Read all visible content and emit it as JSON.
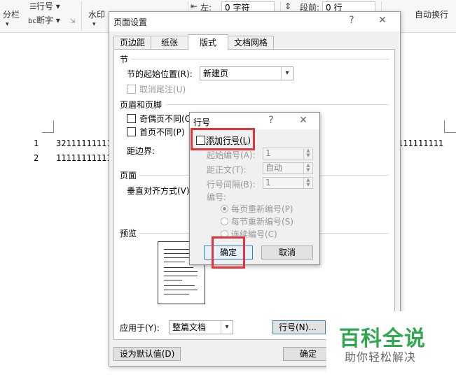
{
  "ribbon": {
    "columns_label": "分栏",
    "line_numbers_label": "行号",
    "hyphenation_label": "断字",
    "watermark_label": "水印",
    "left_indent_label": "左:",
    "left_indent_value": "0 字符",
    "spacing_before_label": "段前:",
    "spacing_before_value": "0 行",
    "auto_wrap_label": "自动换行"
  },
  "document": {
    "line1_number": "1",
    "line1_text": "32111111111",
    "line1_tail": "111111111",
    "line2_number": "2",
    "line2_text": "11111111111"
  },
  "page_setup": {
    "title": "页面设置",
    "help": "?",
    "close": "✕",
    "tabs": [
      "页边距",
      "纸张",
      "版式",
      "文档网格"
    ],
    "section_heading": "节",
    "section_start_label": "节的起始位置(R):",
    "section_start_value": "新建页",
    "suppress_endnotes_label": "取消尾注(U)",
    "header_footer_heading": "页眉和页脚",
    "odd_even_label": "奇偶页不同(O)",
    "first_page_label": "首页不同(P)",
    "from_edge_label": "距边界:",
    "page_heading": "页面",
    "vertical_align_label": "垂直对齐方式(V)",
    "preview_heading": "预览",
    "apply_to_label": "应用于(Y):",
    "apply_to_value": "整篇文档",
    "line_numbers_button": "行号(N)...",
    "set_default_button": "设为默认值(D)",
    "ok_button": "确定"
  },
  "line_numbers_dialog": {
    "title": "行号",
    "help": "?",
    "close": "✕",
    "add_line_numbers_label": "添加行号(L)",
    "start_at_label": "起始编号(A):",
    "start_at_value": "1",
    "from_text_label": "距正文(T):",
    "from_text_value": "自动",
    "count_by_label": "行号间隔(B):",
    "count_by_value": "1",
    "numbering_label": "编号:",
    "restart_each_page": "每页重新编号(P)",
    "restart_each_section": "每节重新编号(S)",
    "continuous": "连续编号(C)",
    "selected_option": "restart_each_page",
    "ok_button": "确定",
    "cancel_button": "取消"
  },
  "watermark": {
    "title": "百科全说",
    "subtitle": "助你轻松解决"
  },
  "colors": {
    "highlight_red": "#e0353b",
    "watermark_green": "#2fa84f"
  }
}
